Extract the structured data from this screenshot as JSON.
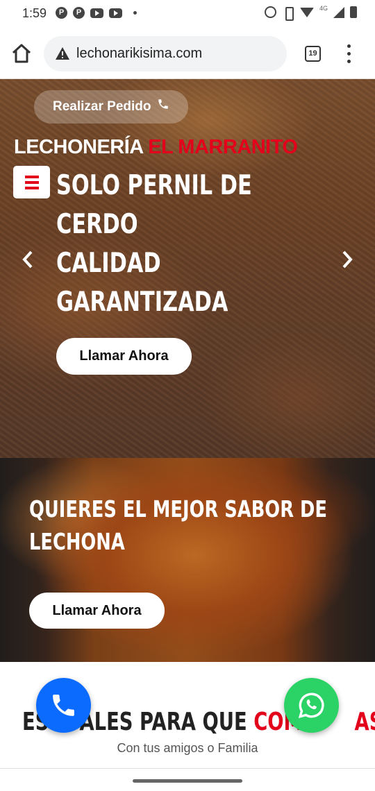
{
  "status_bar": {
    "time": "1:59",
    "network": "4G"
  },
  "browser": {
    "url": "lechonarikisima.com",
    "tab_count": "19"
  },
  "hero1": {
    "order_button": "Realizar Pedido",
    "brand_white": "LECHONERÍA",
    "brand_red": "EL MARRANITO",
    "title_lines": [
      "SOLO PERNIL DE",
      "CERDO",
      "CALIDAD",
      "GARANTIZADA"
    ],
    "call_button": "Llamar Ahora"
  },
  "hero2": {
    "title_lines": [
      "QUIERES EL MEJOR SABOR DE",
      "LECHONA"
    ],
    "call_button": "Llamar Ahora"
  },
  "bottom": {
    "title_visible_start": "ES",
    "title_middle": "ALES PARA QUE",
    "title_red": "COMP",
    "title_end": "AS",
    "subtitle": "Con tus amigos o Familia"
  },
  "colors": {
    "brand_red": "#e3001b",
    "call_blue": "#0b6bff",
    "whatsapp_green": "#2bd366"
  },
  "icons": {
    "home": "home-icon",
    "insecure": "warning-icon",
    "tabs": "tabs-icon",
    "menu": "overflow-menu-icon",
    "phone": "phone-icon",
    "whatsapp": "whatsapp-icon",
    "hamburger": "hamburger-icon",
    "prev": "chevron-left-icon",
    "next": "chevron-right-icon"
  }
}
